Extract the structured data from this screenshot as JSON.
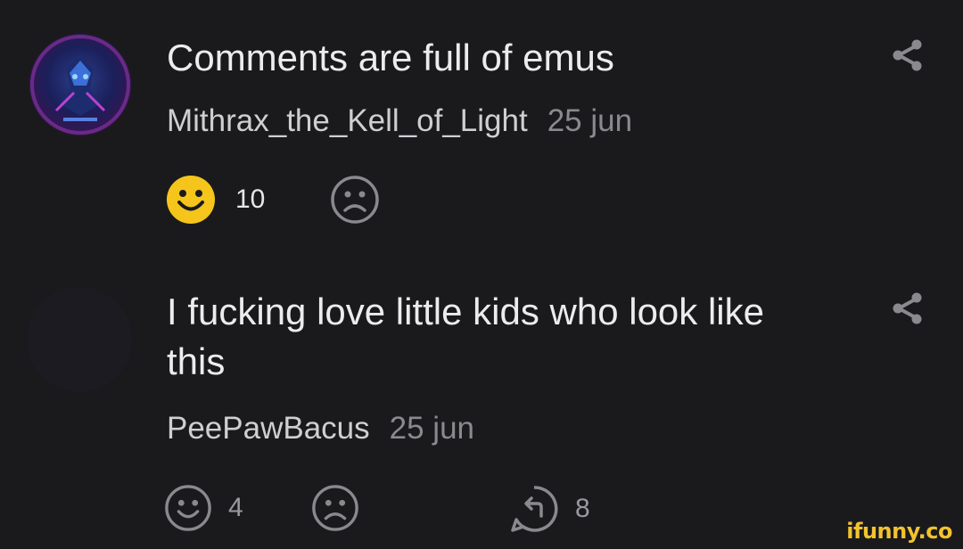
{
  "comments": [
    {
      "text": "Comments are full of emus",
      "author": "Mithrax_the_Kell_of_Light",
      "date": "25 jun",
      "likes": "10"
    },
    {
      "text": "I fucking love little kids who look like this",
      "author": "PeePawBacus",
      "date": "25 jun",
      "likes": "4",
      "replies": "8"
    }
  ],
  "watermark": "ifunny.co",
  "colors": {
    "background": "#1a1a1d",
    "smile_active": "#f5c51b",
    "icon_gray": "#8a8a8e",
    "watermark": "#f2c230"
  }
}
